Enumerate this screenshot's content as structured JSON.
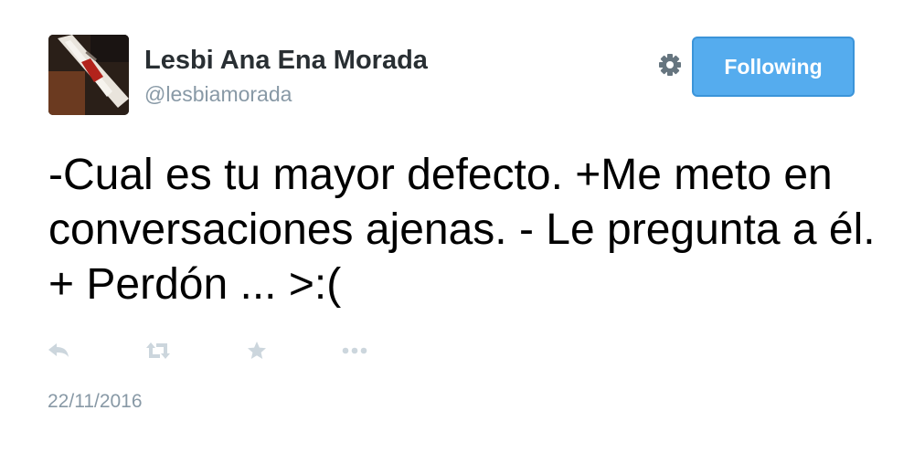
{
  "user": {
    "display_name": "Lesbi Ana Ena Morada",
    "handle": "@lesbiamorada"
  },
  "follow_button": {
    "label": "Following",
    "color": "#55acee"
  },
  "tweet": {
    "text": "-Cual es tu mayor defecto. +Me meto en conversaciones ajenas. - Le pregunta a él. + Perdón ... >:(",
    "timestamp": "22/11/2016"
  },
  "icons": {
    "settings": "gear-icon",
    "reply": "reply-icon",
    "retweet": "retweet-icon",
    "favorite": "star-icon",
    "more": "more-icon"
  },
  "colors": {
    "text": "#000000",
    "name": "#292f33",
    "muted": "#8899a6",
    "icon": "#ccd6dd",
    "gear": "#66757f"
  }
}
